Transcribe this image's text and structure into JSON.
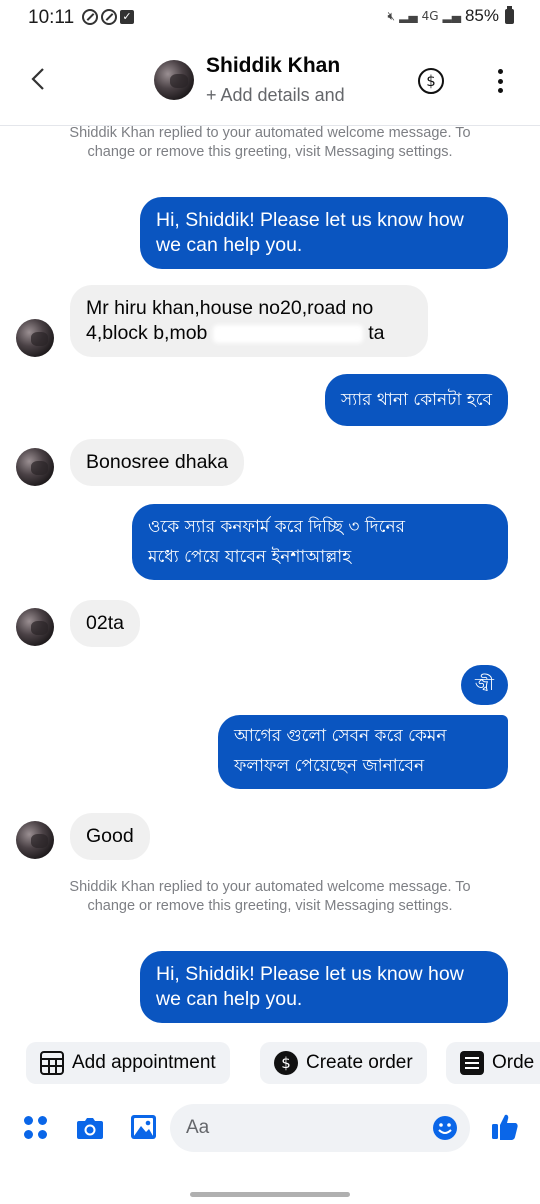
{
  "status_bar": {
    "time": "10:11",
    "network": "4G",
    "battery": "85%"
  },
  "header": {
    "contact_name": "Shiddik Khan",
    "subtitle": "+ Add details and"
  },
  "messages": {
    "system_1": "Shiddik Khan replied to your automated welcome message. To change or remove this greeting, visit Messaging settings.",
    "out_1": "Hi, Shiddik! Please let us know how we can help you.",
    "in_1_line1": "Mr hiru khan,house no20,road no",
    "in_1_line2_start": "4,block b,mob",
    "in_1_line2_end": "ta",
    "out_2": "স্যার থানা কোনটা হবে",
    "in_2": "Bonosree dhaka",
    "out_3_line1": "ওকে স্যার কনফার্ম করে দিচ্ছি ৩ দিনের",
    "out_3_line2": "মধ্যে পেয়ে যাবেন ইনশাআল্লাহ",
    "in_3": "02ta",
    "out_4": "জ্বী",
    "out_5_line1": "আগের গুলো সেবন করে কেমন",
    "out_5_line2": "ফলাফল পেয়েছেন জানাবেন",
    "in_4": "Good",
    "system_2": "Shiddik Khan replied to your automated welcome message. To change or remove this greeting, visit Messaging settings.",
    "out_6": "Hi, Shiddik! Please let us know how we can help you."
  },
  "quick_actions": {
    "add_appointment": "Add appointment",
    "create_order": "Create order",
    "orders": "Orde"
  },
  "composer": {
    "placeholder": "Aa"
  },
  "colors": {
    "outgoing_bubble": "#0a55c0",
    "incoming_bubble": "#f0f0f0",
    "accent": "#0a66e8"
  },
  "icons": [
    "back-arrow-icon",
    "dollar-icon",
    "more-icon",
    "apps-icon",
    "camera-icon",
    "image-icon",
    "emoji-icon",
    "like-icon",
    "calendar-icon",
    "list-icon"
  ]
}
